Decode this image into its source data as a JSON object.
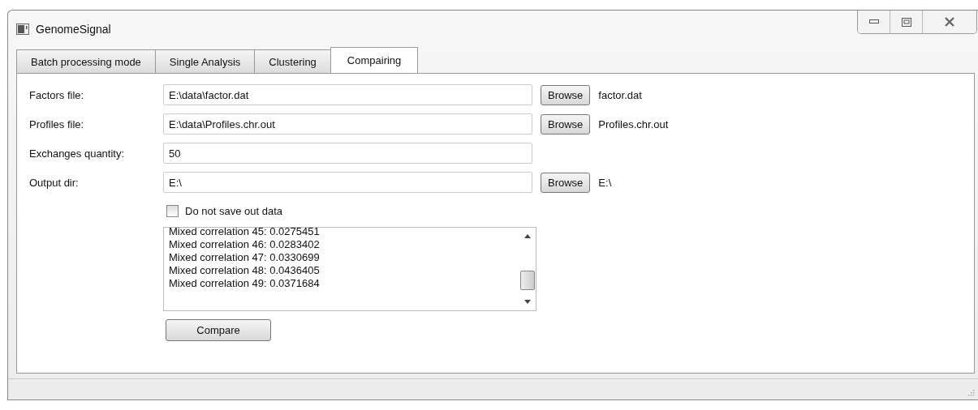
{
  "window": {
    "title": "GenomeSignal"
  },
  "tabs": [
    {
      "label": "Batch processing mode",
      "selected": false
    },
    {
      "label": "Single Analysis",
      "selected": false
    },
    {
      "label": "Clustering",
      "selected": false
    },
    {
      "label": "Compairing",
      "selected": true
    }
  ],
  "form": [
    {
      "label": "Factors file:",
      "value": "E:\\data\\factor.dat",
      "button": "Browse",
      "chosen": "factor.dat"
    },
    {
      "label": "Profiles file:",
      "value": "E:\\data\\Profiles.chr.out",
      "button": "Browse",
      "chosen": "Profiles.chr.out"
    },
    {
      "label": "Exchanges quantity:",
      "value": "50"
    },
    {
      "label": "Output dir:",
      "value": "E:\\",
      "button": "Browse",
      "chosen": "E:\\"
    }
  ],
  "checkbox": {
    "label": "Do not save out data",
    "checked": false
  },
  "log": [
    "Mixed correlation 45: 0.0275451",
    "Mixed correlation 46: 0.0283402",
    "Mixed correlation 47: 0.0330699",
    "Mixed correlation 48: 0.0436405",
    "Mixed correlation 49: 0.0371684"
  ],
  "compare_button": "Compare"
}
